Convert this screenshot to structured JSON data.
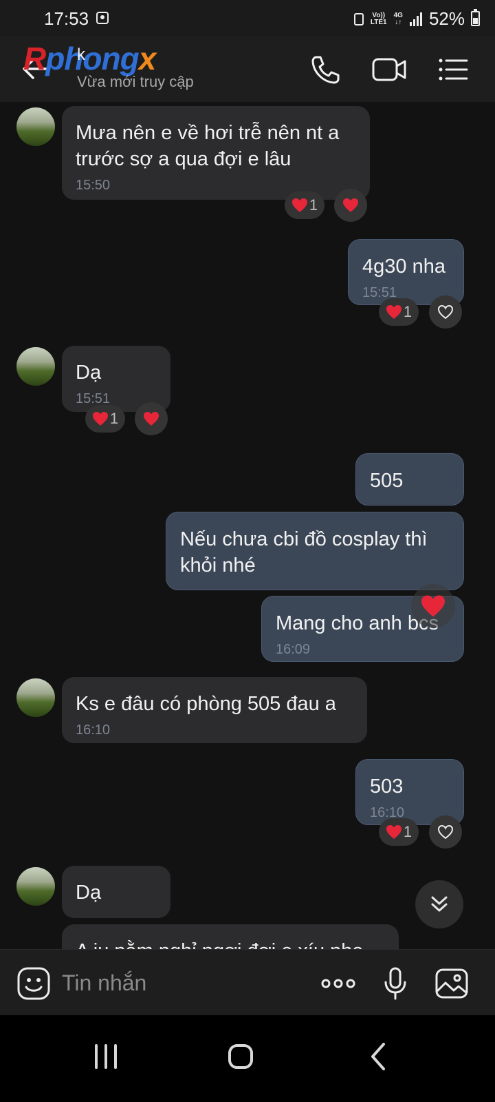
{
  "status_bar": {
    "time": "17:53",
    "network_top": "Vo))",
    "network_bottom": "LTE1",
    "network_type": "4G",
    "battery": "52%"
  },
  "header": {
    "watermark_parts": [
      "R",
      "phong",
      "x"
    ],
    "contact_name": "k",
    "status": "Vừa mới truy cập",
    "icons": [
      "back-arrow-icon",
      "phone-icon",
      "video-camera-icon",
      "menu-list-icon"
    ]
  },
  "messages": [
    {
      "dir": "in",
      "text": "Mưa nên e về hơi trễ nên nt a trước sợ a qua đợi e lâu",
      "time": "15:50",
      "reaction_count": "1"
    },
    {
      "dir": "out",
      "text": "4g30 nha",
      "time": "15:51",
      "reaction_count": "1"
    },
    {
      "dir": "in",
      "text": "Dạ",
      "time": "15:51",
      "reaction_count": "1"
    },
    {
      "dir": "out",
      "text": "505",
      "time": ""
    },
    {
      "dir": "out",
      "text": "Nếu chưa cbi đồ cosplay thì khỏi nhé",
      "time": ""
    },
    {
      "dir": "out",
      "text": "Mang cho anh bcs",
      "time": "16:09"
    },
    {
      "dir": "in",
      "text": "Ks e đâu có phòng 505 đau a",
      "time": "16:10"
    },
    {
      "dir": "out",
      "text": "503",
      "time": "16:10",
      "reaction_count": "1"
    },
    {
      "dir": "in",
      "text": "Dạ",
      "time": ""
    },
    {
      "dir": "in",
      "text": "A iu nằm nghỉ ngơi đợi e xíu nha",
      "time": ""
    }
  ],
  "composer": {
    "placeholder": "Tin nhắn",
    "icons": [
      "emoji-icon",
      "more-options-icon",
      "microphone-icon",
      "image-gallery-icon"
    ]
  },
  "colors": {
    "incoming_bubble": "#2c2c2e",
    "outgoing_bubble": "#3b4656",
    "reaction_heart": "#e8263a",
    "background": "#121212"
  }
}
